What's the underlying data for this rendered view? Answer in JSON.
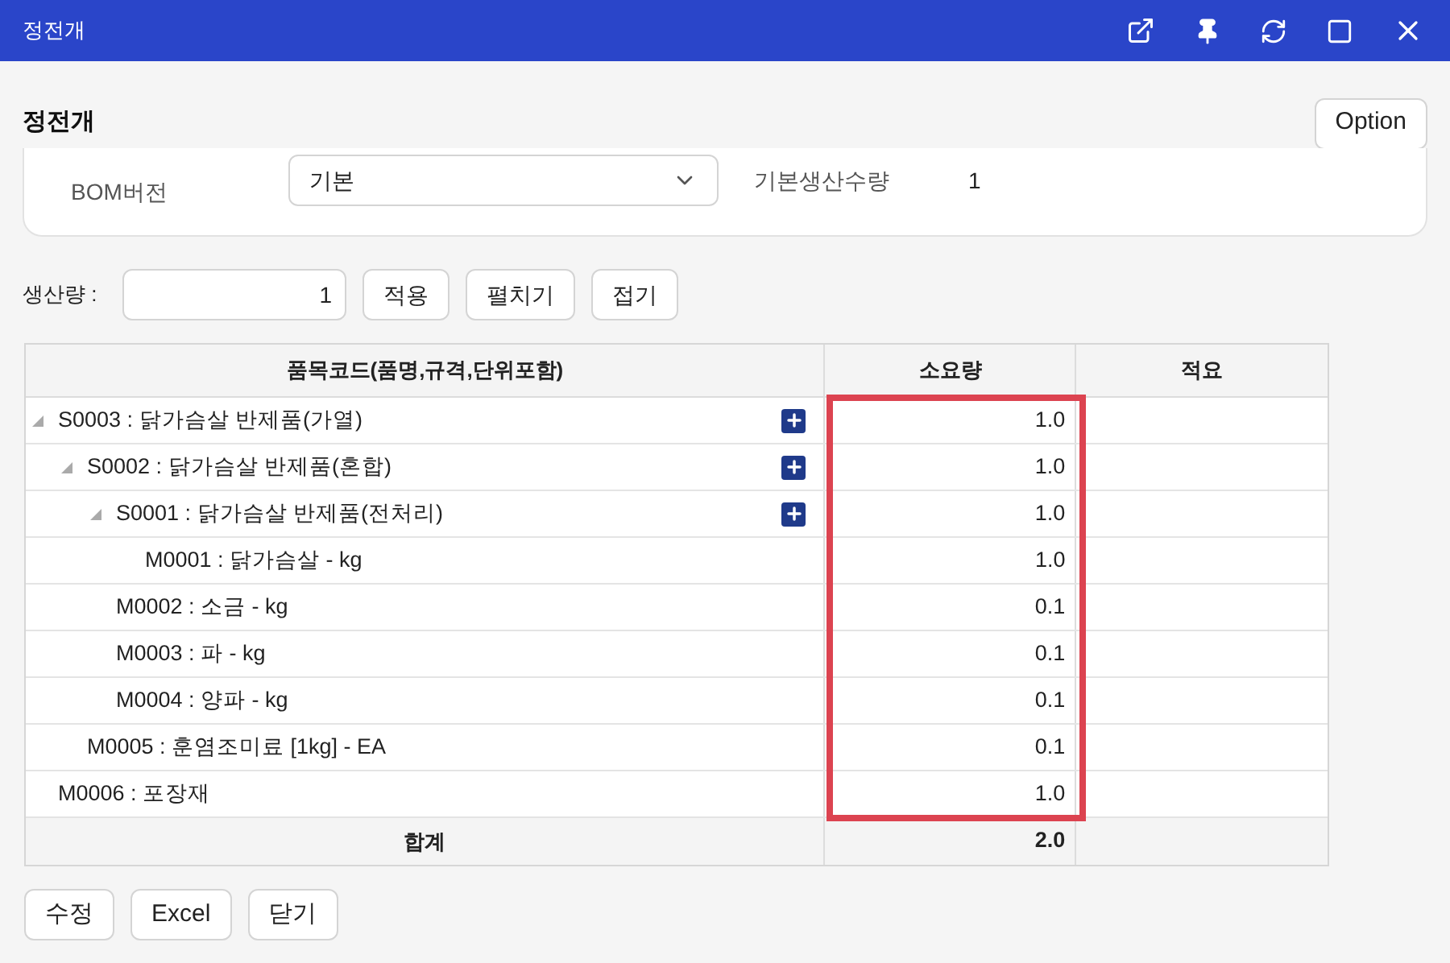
{
  "window": {
    "title": "정전개"
  },
  "page_title": "정전개",
  "option_button": "Option",
  "form": {
    "bom_label": "BOM버전",
    "bom_value": "기본",
    "base_qty_label": "기본생산수량",
    "base_qty_value": "1"
  },
  "production": {
    "label": "생산량 :",
    "value": "1",
    "buttons": [
      "적용",
      "펼치기",
      "접기"
    ]
  },
  "table": {
    "columns": [
      "품목코드(품명,규격,단위포함)",
      "소요량",
      "적요"
    ],
    "quantity_highlighted": true,
    "rows": [
      {
        "item": "S0003 : 닭가슴살 반제품(가열)",
        "quantity": "1.0",
        "expanded": true,
        "children": [
          {
            "item": "S0002 : 닭가슴살 반제품(혼합)",
            "quantity": "1.0",
            "expanded": true,
            "children": [
              {
                "item": "S0001 : 닭가슴살 반제품(전처리)",
                "quantity": "1.0",
                "expanded": true,
                "children": [
                  {
                    "item": "M0001 : 닭가슴살 - kg",
                    "quantity": "1.0"
                  }
                ]
              },
              {
                "item": "M0002 : 소금 - kg",
                "quantity": "0.1"
              },
              {
                "item": "M0003 : 파 - kg",
                "quantity": "0.1"
              },
              {
                "item": "M0004 : 양파 - kg",
                "quantity": "0.1"
              }
            ]
          },
          {
            "item": "M0005 : 훈염조미료 [1kg] - EA",
            "quantity": "0.1"
          }
        ]
      },
      {
        "item": "M0006 : 포장재",
        "quantity": "1.0"
      }
    ],
    "total": {
      "label": "합계",
      "quantity": "2.0"
    }
  },
  "footer_buttons": [
    "수정",
    "Excel",
    "닫기"
  ]
}
